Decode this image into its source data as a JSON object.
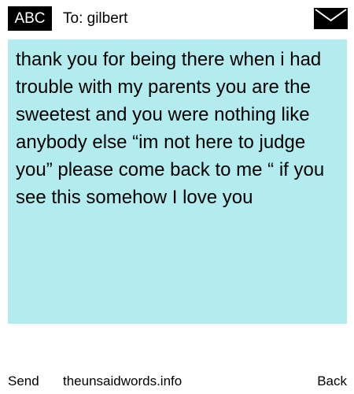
{
  "header": {
    "mode_label": "ABC",
    "recipient": "To: gilbert",
    "envelope_icon": "envelope-icon"
  },
  "message": {
    "text": "thank you for being there when i had trouble with my parents you are the sweetest and you were nothing like anybody else “im not here to judge you” please come back to me “ if you see this somehow I love you",
    "background": "#b2ecee"
  },
  "footer": {
    "send_label": "Send",
    "site_label": "theunsaidwords.info",
    "back_label": "Back"
  }
}
